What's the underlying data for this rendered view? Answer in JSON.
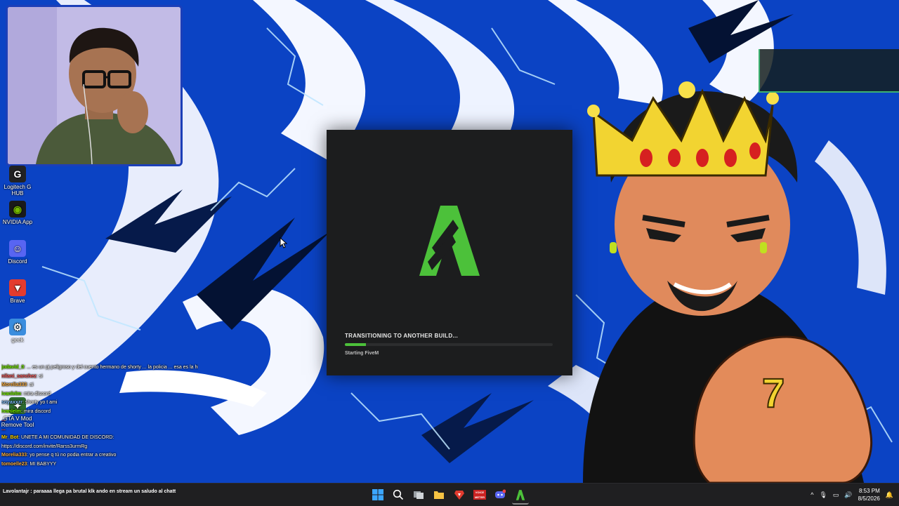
{
  "desktop": {
    "icons": [
      {
        "label_line1": "Logitech G",
        "label_line2": "HUB",
        "icon": "logitech-icon",
        "color": "#1a1a1a"
      },
      {
        "label_line1": "NVIDIA App",
        "label_line2": "",
        "icon": "nvidia-icon",
        "color": "#1a1a1a"
      },
      {
        "label_line1": "Discord",
        "label_line2": "",
        "icon": "discord-icon",
        "color": "#5865f2"
      },
      {
        "label_line1": "Brave",
        "label_line2": "",
        "icon": "brave-icon",
        "color": "#e33b2e"
      },
      {
        "label_line1": "geek",
        "label_line2": "",
        "icon": "geek-icon",
        "color": "#3a8dde"
      },
      {
        "label_line1": "GTA V Mod",
        "label_line2": "Remove Tool",
        "icon": "gta-mod-icon",
        "color": "#2d6b2d"
      }
    ]
  },
  "loader": {
    "status": "TRANSITIONING TO ANOTHER BUILD...",
    "substatus": "Starting FiveM",
    "progress": 0.1,
    "accent": "#4cc13a",
    "logo_icon": "fivem-logo-icon"
  },
  "chat": {
    "lines": [
      {
        "user": "jodavid_0",
        "text": ": ... es un pj peligroso y del cuento hermano de shorty ... la policia ... esa es la historia y ... su pj con los sentimientos frios",
        "color": "#7cfc00"
      },
      {
        "user": "nilani_sanchez",
        "text": ": si",
        "color": "#ff6060"
      },
      {
        "user": "Morelia333",
        "text": ": ai",
        "color": "#ffb347"
      },
      {
        "user": "ivanlelm",
        "text": ": mira discord",
        "color": "#7cfc00"
      },
      {
        "user": "soyaxxzr",
        "text": ": shorty yo t ami",
        "color": "#80c0ff"
      },
      {
        "user": "ivanlelm",
        "text": ": mira discord",
        "color": "#7cfc00"
      },
      {
        "user": "...",
        "text": "",
        "color": "#ff6060"
      },
      {
        "user": "...",
        "text": "",
        "color": "#ff6060"
      },
      {
        "user": "Mr_Bot",
        "text": ": UNETE A MI COMUNIDAD DE DISCORD:",
        "color": "#ffd700"
      },
      {
        "user": "",
        "text": "https://discord.com/invite/Rarss3urmRg",
        "color": "#8ab4ff"
      },
      {
        "user": "Morelia333",
        "text": ": yo pense q tú no podia entrar a creativo",
        "color": "#ffb347"
      },
      {
        "user": "tomoelle23",
        "text": ": MI BABYYY",
        "color": "#ffb347"
      }
    ]
  },
  "taskbar": {
    "chat_line": "Lavolantajr : paraaaa llega pa brutal klk ando en stream un saludo al chatt",
    "apps": [
      {
        "icon": "windows-start-icon"
      },
      {
        "icon": "search-icon"
      },
      {
        "icon": "task-view-icon"
      },
      {
        "icon": "file-explorer-icon"
      },
      {
        "icon": "brave-icon"
      },
      {
        "icon": "voicemeeter-icon",
        "label": "VOICE METER"
      },
      {
        "icon": "discord-icon"
      },
      {
        "icon": "fivem-icon"
      }
    ],
    "time": "8:53 PM",
    "date": "8/5/2026"
  },
  "colors": {
    "wallpaper_blue": "#0d47c8",
    "taskbar": "#1f1f21",
    "loader_bg": "#1c1d1e"
  }
}
